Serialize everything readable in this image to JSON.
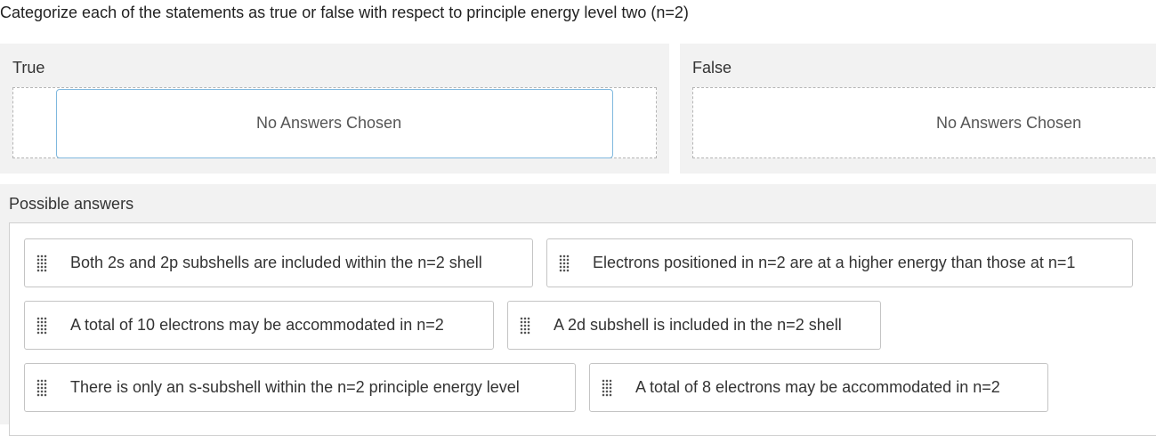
{
  "prompt": "Categorize each of the statements as true or false with respect to principle energy level two (n=2)",
  "buckets": [
    {
      "title": "True",
      "empty_text": "No Answers Chosen"
    },
    {
      "title": "False",
      "empty_text": "No Answers Chosen"
    }
  ],
  "possible": {
    "title": "Possible answers",
    "items": [
      {
        "label": "Both 2s and 2p subshells are included within the n=2 shell"
      },
      {
        "label": "Electrons positioned in n=2 are at a higher energy than those at n=1"
      },
      {
        "label": "A total of 10 electrons may be accommodated in n=2"
      },
      {
        "label": "A 2d subshell is included in the n=2 shell"
      },
      {
        "label": "There is only an s-subshell within the n=2 principle energy level"
      },
      {
        "label": "A total of 8 electrons may be accommodated in n=2"
      }
    ]
  },
  "icons": {
    "drag_handle": "drag-handle-icon"
  }
}
